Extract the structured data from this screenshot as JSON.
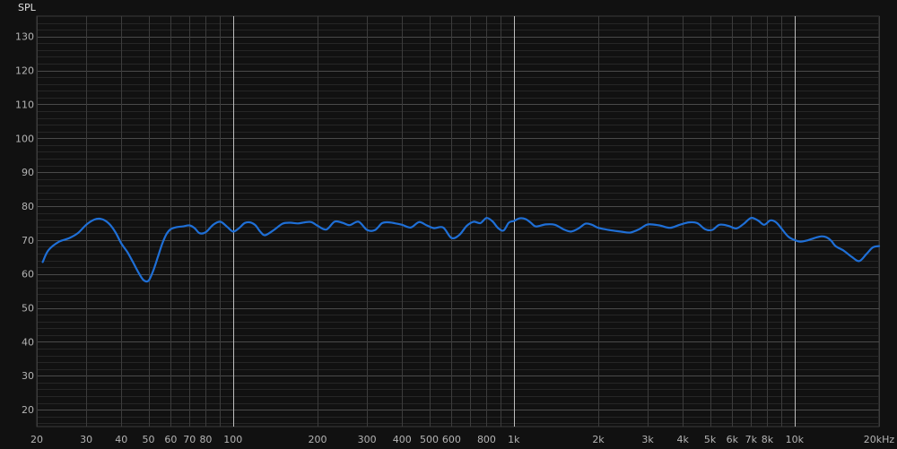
{
  "chart_data": {
    "type": "line",
    "title": "",
    "ylabel": "SPL",
    "xlabel": "",
    "x_scale": "log",
    "xlim": [
      20,
      20000
    ],
    "ylim": [
      15,
      136
    ],
    "grid": true,
    "y_ticks": [
      20,
      30,
      40,
      50,
      60,
      70,
      80,
      90,
      100,
      110,
      120,
      130
    ],
    "x_ticks": [
      {
        "value": 20,
        "label": "20"
      },
      {
        "value": 30,
        "label": "30"
      },
      {
        "value": 40,
        "label": "40"
      },
      {
        "value": 50,
        "label": "50"
      },
      {
        "value": 60,
        "label": "60"
      },
      {
        "value": 70,
        "label": "70"
      },
      {
        "value": 80,
        "label": "80"
      },
      {
        "value": 100,
        "label": "100"
      },
      {
        "value": 200,
        "label": "200"
      },
      {
        "value": 300,
        "label": "300"
      },
      {
        "value": 400,
        "label": "400"
      },
      {
        "value": 500,
        "label": "500"
      },
      {
        "value": 600,
        "label": "600"
      },
      {
        "value": 800,
        "label": "800"
      },
      {
        "value": 1000,
        "label": "1k"
      },
      {
        "value": 2000,
        "label": "2k"
      },
      {
        "value": 3000,
        "label": "3k"
      },
      {
        "value": 4000,
        "label": "4k"
      },
      {
        "value": 5000,
        "label": "5k"
      },
      {
        "value": 6000,
        "label": "6k"
      },
      {
        "value": 7000,
        "label": "7k"
      },
      {
        "value": 8000,
        "label": "8k"
      },
      {
        "value": 10000,
        "label": "10k"
      },
      {
        "value": 20000,
        "label": "20kHz"
      }
    ],
    "major_x_lines": [
      100,
      1000,
      10000
    ],
    "line_color": "#1f6fd6",
    "series": [
      {
        "x": [
          21,
          22,
          24,
          26,
          28,
          30,
          32,
          34,
          36,
          38,
          40,
          42,
          44,
          46,
          48,
          50,
          52,
          54,
          56,
          58,
          60,
          63,
          66,
          70,
          73,
          76,
          80,
          85,
          90,
          95,
          100,
          105,
          110,
          115,
          120,
          125,
          130,
          140,
          150,
          160,
          170,
          180,
          190,
          200,
          215,
          230,
          245,
          260,
          280,
          300,
          320,
          340,
          360,
          380,
          400,
          430,
          460,
          490,
          520,
          560,
          600,
          640,
          680,
          720,
          760,
          800,
          840,
          880,
          920,
          960,
          1000,
          1050,
          1100,
          1150,
          1200,
          1300,
          1400,
          1500,
          1600,
          1700,
          1800,
          1900,
          2000,
          2200,
          2400,
          2600,
          2800,
          3000,
          3300,
          3600,
          3900,
          4200,
          4500,
          4800,
          5100,
          5400,
          5800,
          6200,
          6600,
          7000,
          7400,
          7800,
          8200,
          8600,
          9000,
          9500,
          10000,
          10500,
          11000,
          11500,
          12000,
          12500,
          13000,
          13500,
          14000,
          15000,
          16000,
          17000,
          18000,
          19000,
          20000
        ],
        "y": [
          63.5,
          67,
          69.5,
          70.5,
          72,
          74.5,
          76,
          76.2,
          75,
          72.5,
          69,
          66.5,
          63.5,
          60.5,
          58.2,
          58,
          61,
          65,
          69,
          71.8,
          73.2,
          73.8,
          74,
          74.3,
          73.5,
          72,
          72.3,
          74.5,
          75.4,
          74,
          72.5,
          73.5,
          75,
          75.2,
          74.4,
          72.5,
          71.4,
          73,
          74.8,
          75.1,
          74.9,
          75.2,
          75.3,
          74.2,
          73.1,
          75.4,
          75.1,
          74.4,
          75.4,
          73,
          72.9,
          75,
          75.2,
          74.9,
          74.5,
          73.7,
          75.3,
          74.3,
          73.5,
          73.7,
          70.6,
          71.5,
          74.2,
          75.4,
          75,
          76.5,
          75.5,
          73.5,
          72.8,
          75.1,
          75.6,
          76.4,
          76.2,
          75.1,
          74,
          74.6,
          74.5,
          73.2,
          72.5,
          73.4,
          74.8,
          74.5,
          73.6,
          72.9,
          72.5,
          72.2,
          73.2,
          74.6,
          74.3,
          73.6,
          74.5,
          75.2,
          75,
          73.2,
          73,
          74.5,
          74.2,
          73.4,
          74.8,
          76.5,
          75.8,
          74.5,
          75.8,
          75.2,
          73.3,
          71,
          70,
          69.5,
          69.8,
          70.3,
          70.8,
          71.1,
          70.8,
          69.8,
          68.2,
          66.8,
          65,
          63.8,
          65.8,
          67.8,
          68.2
        ]
      }
    ]
  }
}
